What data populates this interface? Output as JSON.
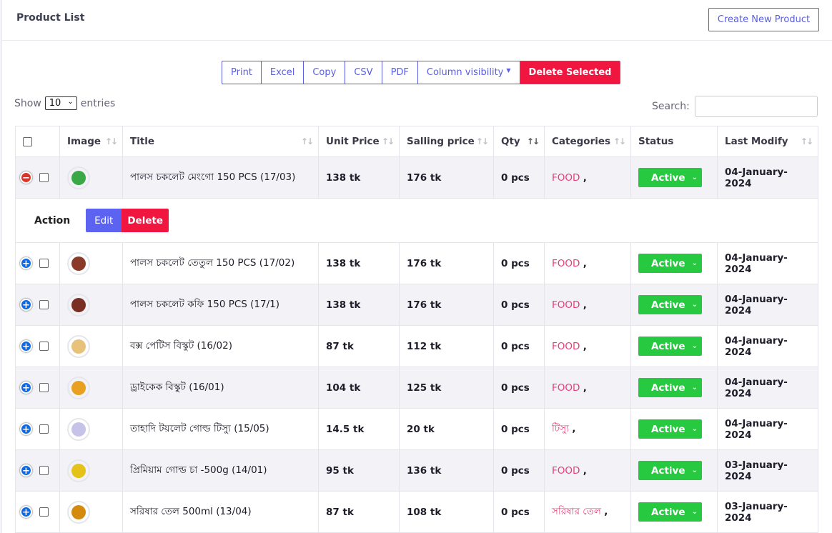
{
  "header": {
    "title": "Product List",
    "create_label": "Create New Product"
  },
  "toolbar": {
    "print": "Print",
    "excel": "Excel",
    "copy": "Copy",
    "csv": "CSV",
    "pdf": "PDF",
    "column_visibility": "Column visibility",
    "delete_selected": "Delete Selected"
  },
  "entries": {
    "show": "Show",
    "value": "10",
    "suffix": "entries"
  },
  "search": {
    "label": "Search:",
    "value": ""
  },
  "columns": [
    "Image",
    "Title",
    "Unit Price",
    "Salling price",
    "Qty",
    "Categories",
    "Status",
    "Last Modify"
  ],
  "child_row": {
    "action_label": "Action",
    "edit": "Edit",
    "delete": "Delete"
  },
  "rows": [
    {
      "title": "পালস চকলেট মেংগো 150 PCS (17/03)",
      "unit_price": "138 tk",
      "sale_price": "176 tk",
      "qty": "0 pcs",
      "category": "FOOD",
      "status": "Active",
      "modified": "04-January-2024",
      "thumb_color": "#3aa845",
      "expanded": true
    },
    {
      "title": "পালস চকলেট তেতুল 150 PCS (17/02)",
      "unit_price": "138 tk",
      "sale_price": "176 tk",
      "qty": "0 pcs",
      "category": "FOOD",
      "status": "Active",
      "modified": "04-January-2024",
      "thumb_color": "#8b3a2a"
    },
    {
      "title": "পালস চকলেট কফি 150 PCS (17/1)",
      "unit_price": "138 tk",
      "sale_price": "176 tk",
      "qty": "0 pcs",
      "category": "FOOD",
      "status": "Active",
      "modified": "04-January-2024",
      "thumb_color": "#7a2e24"
    },
    {
      "title": "বক্স পেটিস বিস্কুট (16/02)",
      "unit_price": "87 tk",
      "sale_price": "112 tk",
      "qty": "0 pcs",
      "category": "FOOD",
      "status": "Active",
      "modified": "04-January-2024",
      "thumb_color": "#e8c27a"
    },
    {
      "title": "ড্রাইকেক বিস্কুট (16/01)",
      "unit_price": "104 tk",
      "sale_price": "125 tk",
      "qty": "0 pcs",
      "category": "FOOD",
      "status": "Active",
      "modified": "04-January-2024",
      "thumb_color": "#e9a020"
    },
    {
      "title": "তাহাদি টয়লেট গোল্ড টিস্যু (15/05)",
      "unit_price": "14.5 tk",
      "sale_price": "20 tk",
      "qty": "0 pcs",
      "category": "টিস্যু",
      "status": "Active",
      "modified": "04-January-2024",
      "thumb_color": "#c7c3e8"
    },
    {
      "title": "প্রিমিয়াম গোল্ড চা -500g (14/01)",
      "unit_price": "95 tk",
      "sale_price": "136 tk",
      "qty": "0 pcs",
      "category": "FOOD",
      "status": "Active",
      "modified": "03-January-2024",
      "thumb_color": "#e5c21a"
    },
    {
      "title": "সরিষার তেল 500ml (13/04)",
      "unit_price": "87 tk",
      "sale_price": "108 tk",
      "qty": "0 pcs",
      "category": "সরিষার তেল",
      "status": "Active",
      "modified": "03-January-2024",
      "thumb_color": "#d48a0c"
    }
  ]
}
